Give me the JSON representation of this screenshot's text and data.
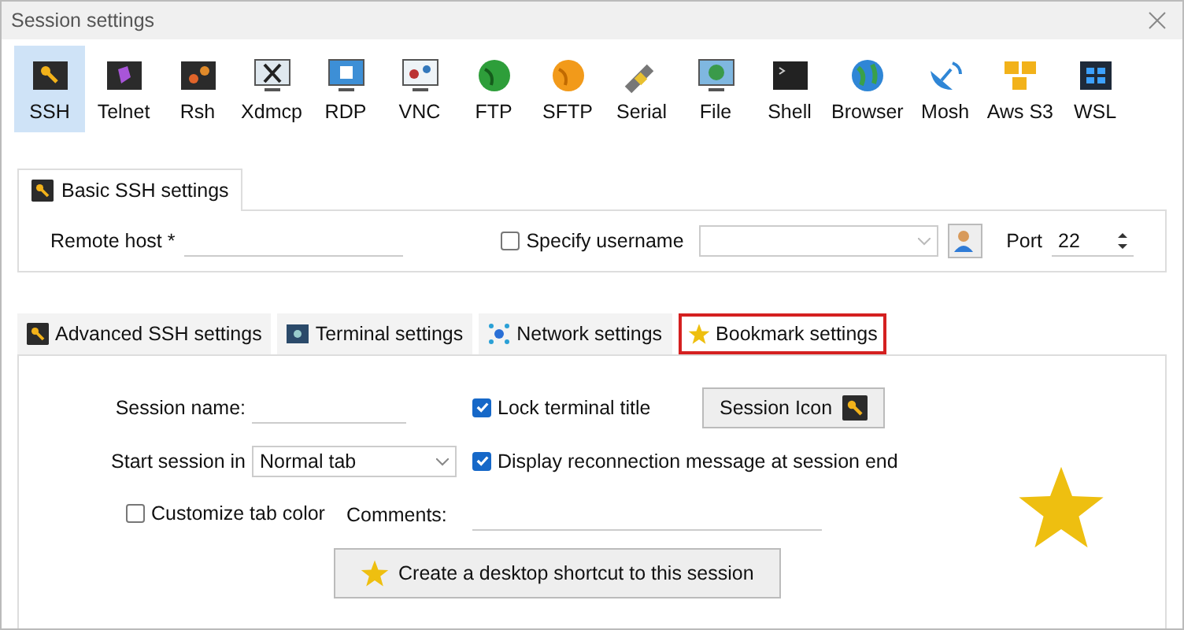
{
  "window": {
    "title": "Session settings"
  },
  "session_types": [
    {
      "label": "SSH",
      "selected": true
    },
    {
      "label": "Telnet",
      "selected": false
    },
    {
      "label": "Rsh",
      "selected": false
    },
    {
      "label": "Xdmcp",
      "selected": false
    },
    {
      "label": "RDP",
      "selected": false
    },
    {
      "label": "VNC",
      "selected": false
    },
    {
      "label": "FTP",
      "selected": false
    },
    {
      "label": "SFTP",
      "selected": false
    },
    {
      "label": "Serial",
      "selected": false
    },
    {
      "label": "File",
      "selected": false
    },
    {
      "label": "Shell",
      "selected": false
    },
    {
      "label": "Browser",
      "selected": false
    },
    {
      "label": "Mosh",
      "selected": false
    },
    {
      "label": "Aws S3",
      "selected": false
    },
    {
      "label": "WSL",
      "selected": false
    }
  ],
  "basic_tab": {
    "label": "Basic SSH settings"
  },
  "basic": {
    "remote_host_label": "Remote host *",
    "specify_username": {
      "label": "Specify username",
      "checked": false
    },
    "port_label": "Port",
    "port": "22"
  },
  "tabs": [
    {
      "label": "Advanced SSH settings",
      "selected": false
    },
    {
      "label": "Terminal settings",
      "selected": false
    },
    {
      "label": "Network settings",
      "selected": false
    },
    {
      "label": "Bookmark settings",
      "selected": true
    }
  ],
  "bookmark": {
    "session_name_label": "Session name:",
    "lock_title": {
      "label": "Lock terminal title",
      "checked": true
    },
    "session_icon_button": "Session Icon",
    "start_label": "Start session in",
    "start_value": "Normal tab",
    "reconnect": {
      "label": "Display reconnection message at session end",
      "checked": true
    },
    "tab_color": {
      "label": "Customize tab color",
      "checked": false
    },
    "comments_label": "Comments:",
    "shortcut_button": "Create a desktop shortcut to this session"
  }
}
